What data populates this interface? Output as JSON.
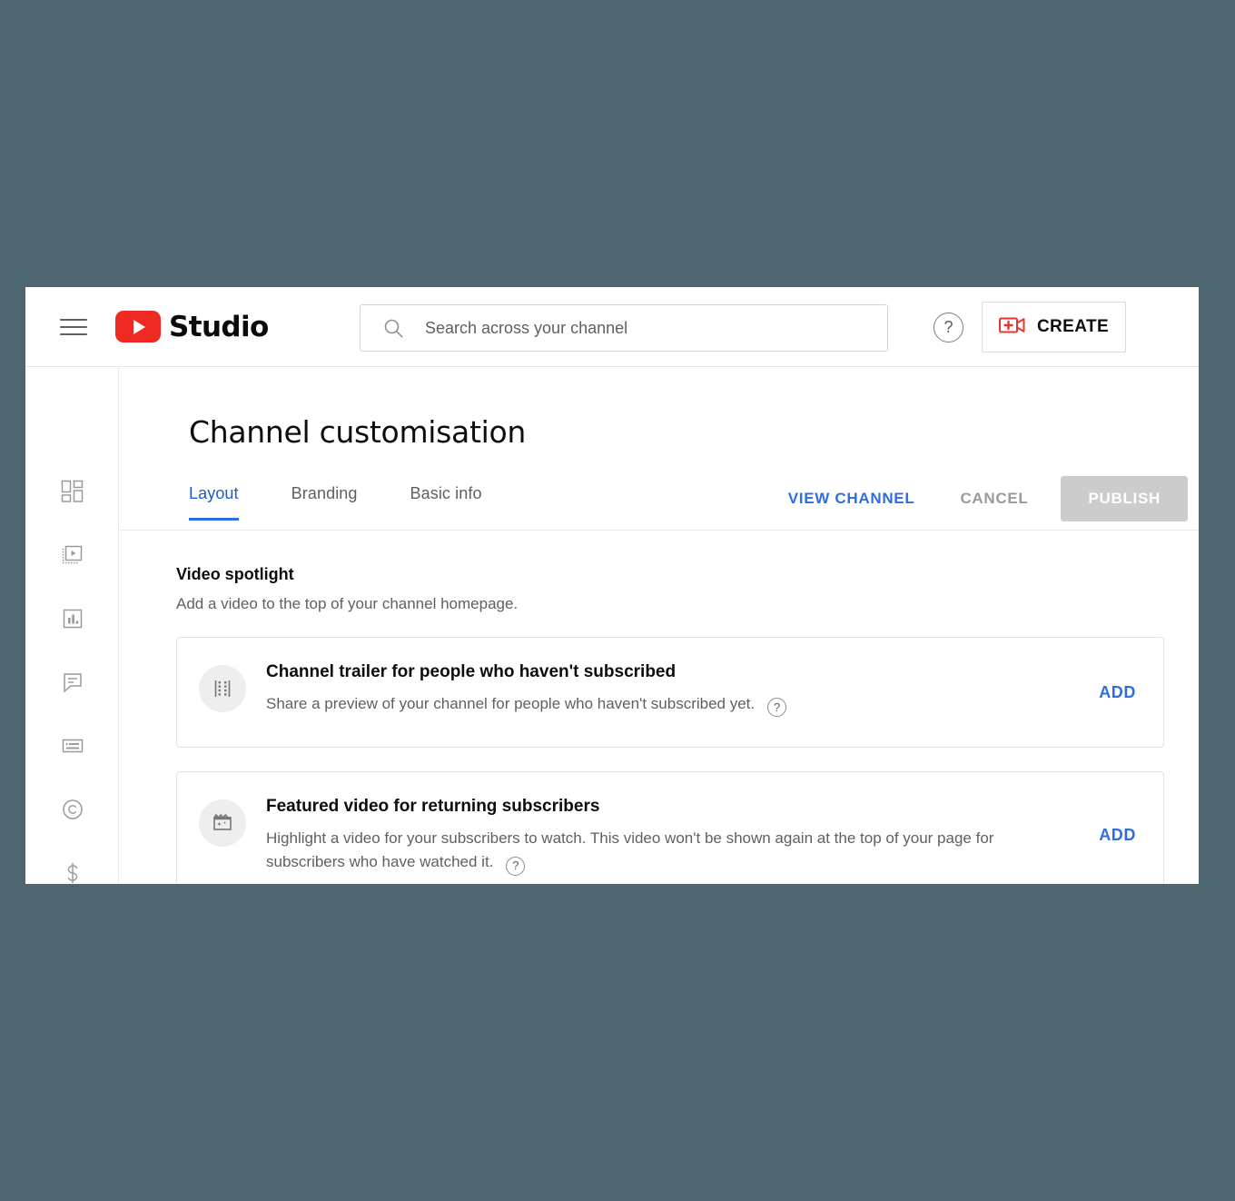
{
  "colors": {
    "page_background": "#4d6670",
    "accent_blue": "#2f6ede",
    "brand_red": "#ef2a24",
    "disabled_gray": "#cccccc",
    "muted_text": "#606060"
  },
  "header": {
    "menu_icon": "hamburger-menu-icon",
    "logo_icon": "youtube-play-logo-icon",
    "brand_text": "Studio",
    "search": {
      "icon": "search-icon",
      "value": "",
      "placeholder": "Search across your channel"
    },
    "help_icon": "question-mark-icon",
    "help_label": "?",
    "create": {
      "icon": "video-camera-plus-icon",
      "label": "CREATE"
    }
  },
  "sidebar": {
    "items": [
      {
        "icon": "dashboard-grid-icon",
        "label": "Dashboard"
      },
      {
        "icon": "content-video-icon",
        "label": "Content"
      },
      {
        "icon": "analytics-bar-chart-icon",
        "label": "Analytics"
      },
      {
        "icon": "comments-speech-bubble-icon",
        "label": "Comments"
      },
      {
        "icon": "subtitles-caption-icon",
        "label": "Subtitles"
      },
      {
        "icon": "copyright-circle-icon",
        "label": "Copyright"
      },
      {
        "icon": "monetisation-dollar-icon",
        "label": "Monetisation"
      }
    ]
  },
  "main": {
    "title": "Channel customisation",
    "tabs": [
      {
        "label": "Layout",
        "active": true
      },
      {
        "label": "Branding",
        "active": false
      },
      {
        "label": "Basic info",
        "active": false
      }
    ],
    "actions": {
      "view_channel": "VIEW CHANNEL",
      "cancel": "CANCEL",
      "publish": "PUBLISH"
    },
    "section": {
      "title": "Video spotlight",
      "subtitle": "Add a video to the top of your channel homepage."
    },
    "cards": [
      {
        "icon": "film-strip-icon",
        "title": "Channel trailer for people who haven't subscribed",
        "description": "Share a preview of your channel for people who haven't subscribed yet.",
        "help_label": "?",
        "action_label": "ADD"
      },
      {
        "icon": "featured-video-marquee-icon",
        "title": "Featured video for returning subscribers",
        "description": "Highlight a video for your subscribers to watch. This video won't be shown again at the top of your page for subscribers who have watched it.",
        "help_label": "?",
        "action_label": "ADD"
      }
    ]
  }
}
